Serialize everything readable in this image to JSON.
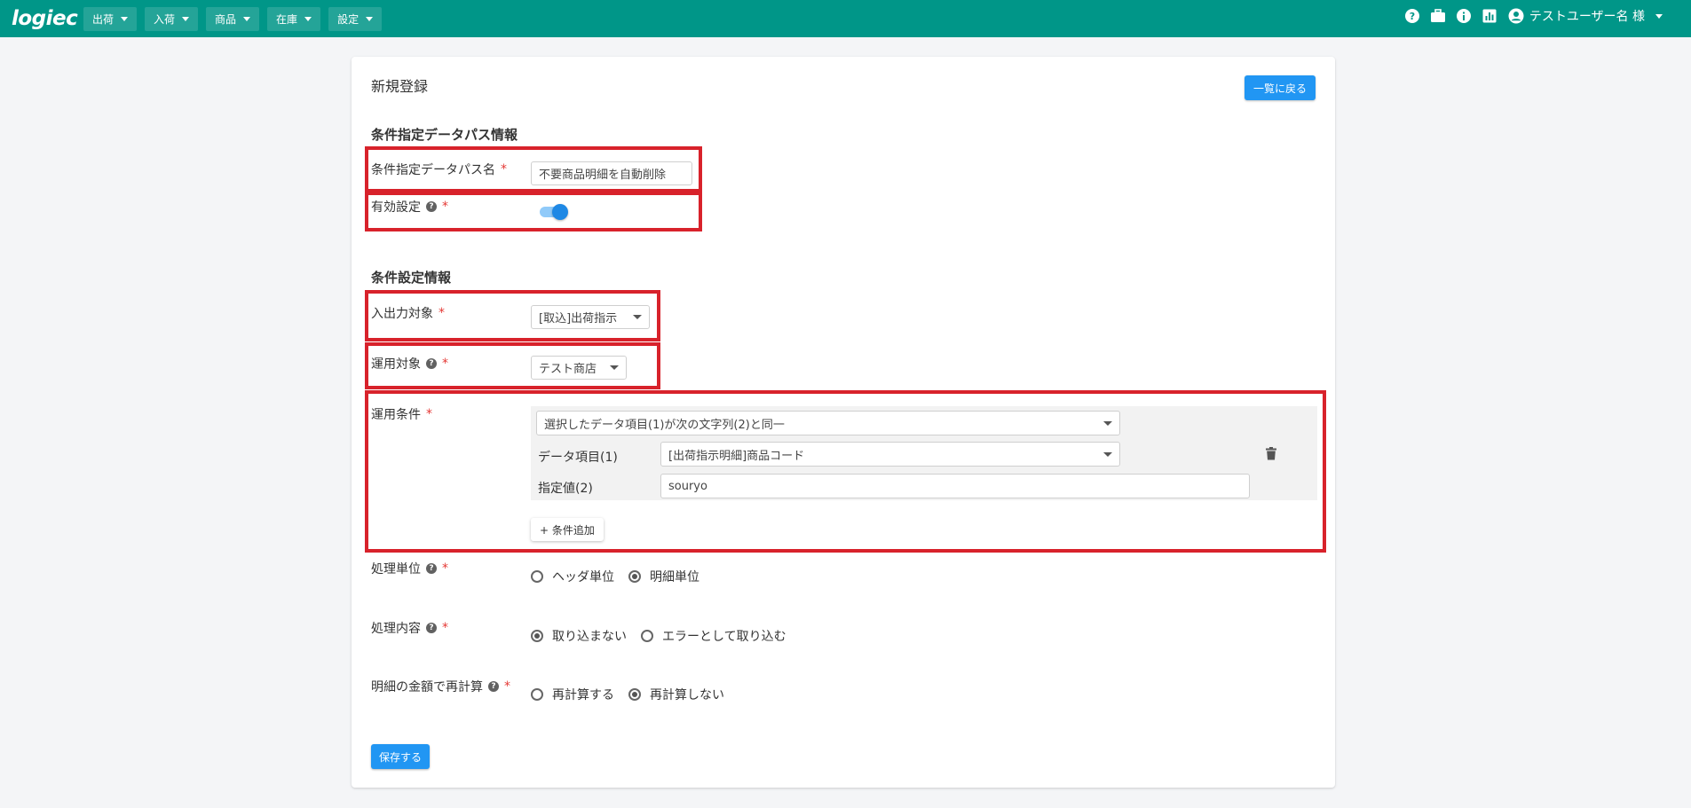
{
  "header": {
    "logo": "logiec",
    "nav": [
      "出荷",
      "入荷",
      "商品",
      "在庫",
      "設定"
    ],
    "user_name": "テストユーザー名 様",
    "icons": [
      "help-circle-icon",
      "briefcase-icon",
      "info-icon",
      "chart-icon",
      "account-circle-icon"
    ]
  },
  "page": {
    "title": "新規登録",
    "back_button": "一覧に戻る"
  },
  "path_info": {
    "heading": "条件指定データパス情報",
    "name_label": "条件指定データパス名",
    "name_value": "不要商品明細を自動削除",
    "enabled_label": "有効設定",
    "enabled": true
  },
  "condition_info": {
    "heading": "条件設定情報",
    "io_target_label": "入出力対象",
    "io_target_value": "[取込]出荷指示",
    "apply_target_label": "運用対象",
    "apply_target_value": "テスト商店",
    "apply_condition_label": "運用条件",
    "condition_type": "選択したデータ項目(1)が次の文字列(2)と同一",
    "data_item_label": "データ項目(1)",
    "data_item_value": "[出荷指示明細]商品コード",
    "specified_value_label": "指定値(2)",
    "specified_value": "souryo",
    "add_condition": "+ 条件追加"
  },
  "processing": {
    "unit_label": "処理単位",
    "unit_options": [
      "ヘッダ単位",
      "明細単位"
    ],
    "unit_selected": "明細単位",
    "content_label": "処理内容",
    "content_options": [
      "取り込まない",
      "エラーとして取り込む"
    ],
    "content_selected": "取り込まない",
    "recalc_label": "明細の金額で再計算",
    "recalc_options": [
      "再計算する",
      "再計算しない"
    ],
    "recalc_selected": "再計算しない"
  },
  "required_mark": "*",
  "help_mark": "?",
  "save_button": "保存する",
  "colors": {
    "header": "#009688",
    "primary": "#2196f3",
    "required": "#e53935",
    "highlight_box": "#d8222b"
  }
}
